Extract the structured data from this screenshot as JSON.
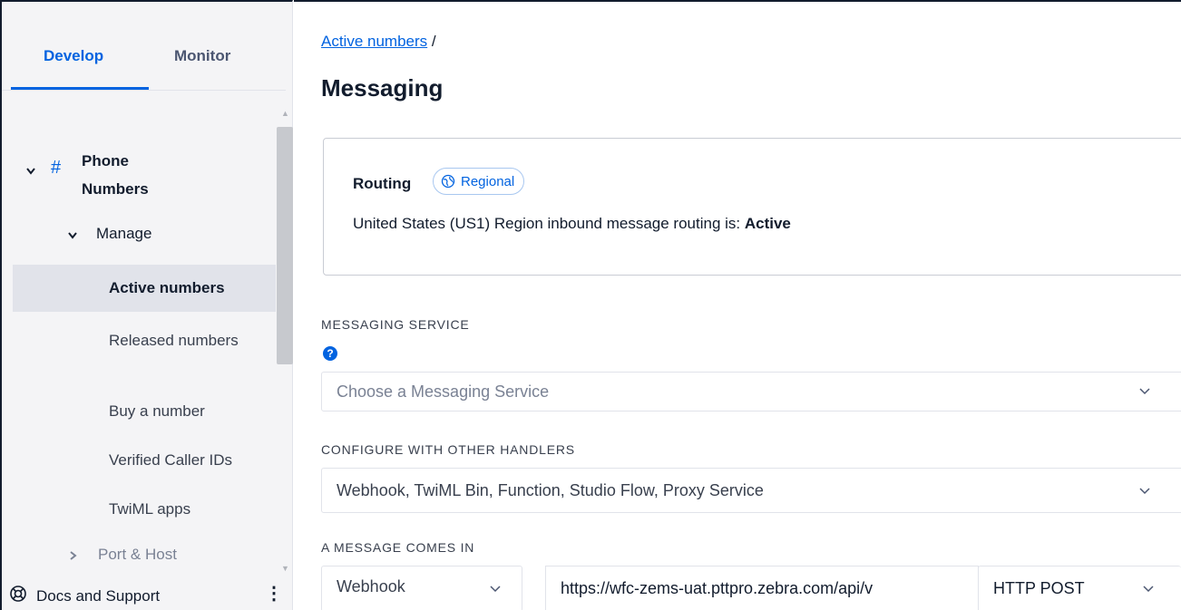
{
  "sidebar": {
    "tabs": [
      {
        "label": "Develop"
      },
      {
        "label": "Monitor"
      }
    ],
    "phone_numbers_label": "Phone Numbers",
    "manage_label": "Manage",
    "items": [
      {
        "label": "Active numbers"
      },
      {
        "label": "Released numbers"
      },
      {
        "label": "Buy a number"
      },
      {
        "label": "Verified Caller IDs"
      },
      {
        "label": "TwiML apps"
      }
    ],
    "port_host_label": "Port & Host",
    "docs_label": "Docs and Support"
  },
  "main": {
    "breadcrumb_link": "Active numbers",
    "breadcrumb_sep": " /",
    "title": "Messaging",
    "routing": {
      "label": "Routing",
      "badge": "Regional",
      "text_prefix": "United States (US1) Region inbound message routing is: ",
      "status": "Active"
    },
    "messaging_service": {
      "label": "MESSAGING SERVICE",
      "placeholder": "Choose a Messaging Service"
    },
    "other_handlers": {
      "label": "CONFIGURE WITH OTHER HANDLERS",
      "value": "Webhook, TwiML Bin, Function, Studio Flow, Proxy Service"
    },
    "message_comes_in": {
      "label": "A MESSAGE COMES IN",
      "type": "Webhook",
      "url": "https://wfc-zems-uat.pttpro.zebra.com/api/v",
      "method": "HTTP POST"
    }
  },
  "colors": {
    "accent": "#0263e0",
    "text": "#121c2d",
    "sidebar_bg": "#f4f4f6",
    "active_item_bg": "#e1e3ea"
  }
}
